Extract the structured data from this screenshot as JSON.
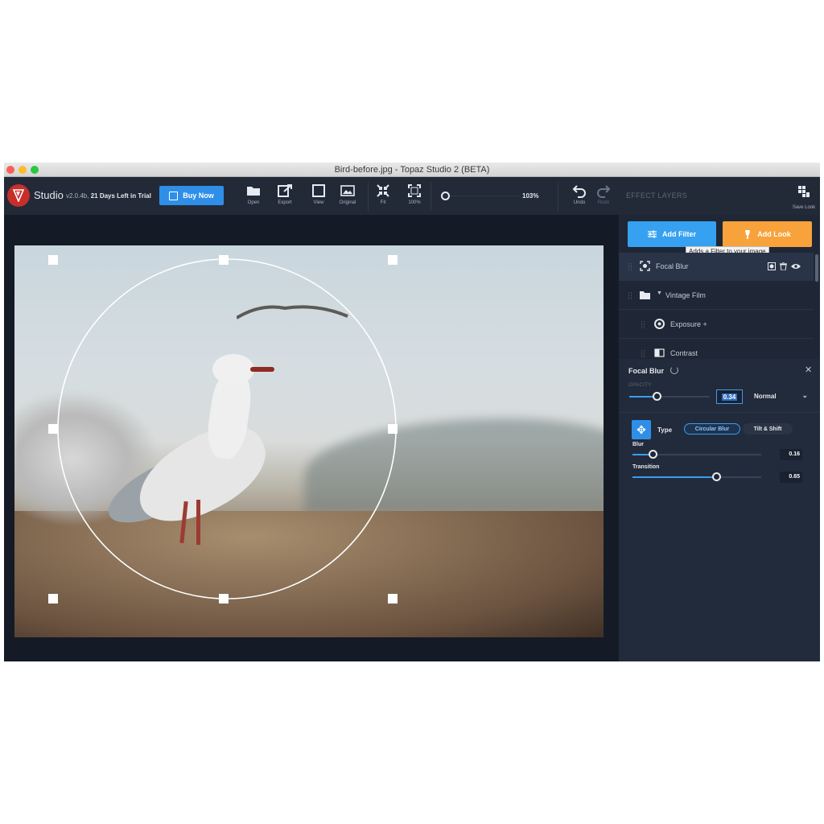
{
  "window": {
    "title": "Bird-before.jpg - Topaz Studio 2 (BETA)"
  },
  "toolbar": {
    "brand": "Studio",
    "version": "v2.0.4b,",
    "trial": "21 Days Left in Trial",
    "buy_label": "Buy Now",
    "tools": [
      {
        "label": "Open",
        "icon": "folder-icon"
      },
      {
        "label": "Export",
        "icon": "export-icon"
      },
      {
        "label": "View",
        "icon": "view-icon"
      },
      {
        "label": "Original",
        "icon": "image-icon"
      },
      {
        "label": "Fit",
        "icon": "fit-icon"
      },
      {
        "label": "100%",
        "icon": "fullsize-icon"
      }
    ],
    "zoom_value": "103%",
    "undo_label": "Undo",
    "redo_label": "Redo"
  },
  "panel": {
    "title": "EFFECT LAYERS",
    "save_look_label": "Save Look",
    "add_filter_label": "Add Filter",
    "add_look_label": "Add Look",
    "tooltip": "Adds a Filter to your image",
    "layers": [
      {
        "name": "Focal Blur",
        "icon": "focal-blur-icon",
        "active": true
      },
      {
        "name": "Vintage Film",
        "icon": "folder-icon",
        "active": false
      },
      {
        "name": "Exposure +",
        "icon": "aperture-icon",
        "active": false
      },
      {
        "name": "Contrast",
        "icon": "contrast-icon",
        "active": false
      }
    ]
  },
  "props": {
    "title": "Focal Blur",
    "opacity_label": "OPACITY",
    "opacity_value": "0.34",
    "opacity": 0.34,
    "blend_mode": "Normal",
    "type_label": "Type",
    "type_options": [
      "Circular Blur",
      "Tilt & Shift"
    ],
    "type_selected": "Circular Blur",
    "params": [
      {
        "label": "Blur",
        "value": "0.16",
        "level": 0.16
      },
      {
        "label": "Transition",
        "value": "0.65",
        "level": 0.65
      }
    ]
  },
  "colors": {
    "accent_blue": "#36a1f0",
    "accent_orange": "#f7a23b",
    "panel_bg": "#1f2737",
    "logo_red": "#c62f2a"
  }
}
